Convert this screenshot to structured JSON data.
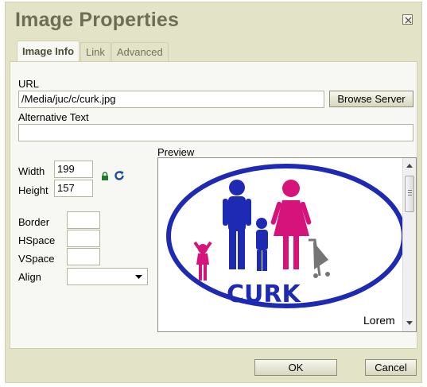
{
  "dialog": {
    "title": "Image Properties",
    "close_label": "close"
  },
  "tabs": [
    {
      "label": "Image Info",
      "active": true
    },
    {
      "label": "Link",
      "active": false
    },
    {
      "label": "Advanced",
      "active": false
    }
  ],
  "image_info": {
    "url_label": "URL",
    "url_value": "/Media/juc/c/curk.jpg",
    "browse_label": "Browse Server",
    "alt_label": "Alternative Text",
    "alt_value": "",
    "width_label": "Width",
    "width_value": "199",
    "height_label": "Height",
    "height_value": "157",
    "border_label": "Border",
    "border_value": "",
    "hspace_label": "HSpace",
    "hspace_value": "",
    "vspace_label": "VSpace",
    "vspace_value": "",
    "align_label": "Align",
    "align_value": ""
  },
  "preview": {
    "label": "Preview",
    "logo_text": "CURK",
    "lorem_text": "Lorem"
  },
  "footer": {
    "ok_label": "OK",
    "cancel_label": "Cancel"
  },
  "colors": {
    "dialog_bg": "#e3e3c7",
    "panel_bg": "#f7f8f3",
    "title_color": "#6e6e57",
    "logo_blue": "#1e29b4",
    "logo_pink": "#d6137a",
    "logo_gray": "#757575"
  },
  "icons": {
    "close": "close-icon",
    "lock": "lock-icon",
    "reset": "reset-size-icon",
    "dropdown": "chevron-down-icon"
  }
}
